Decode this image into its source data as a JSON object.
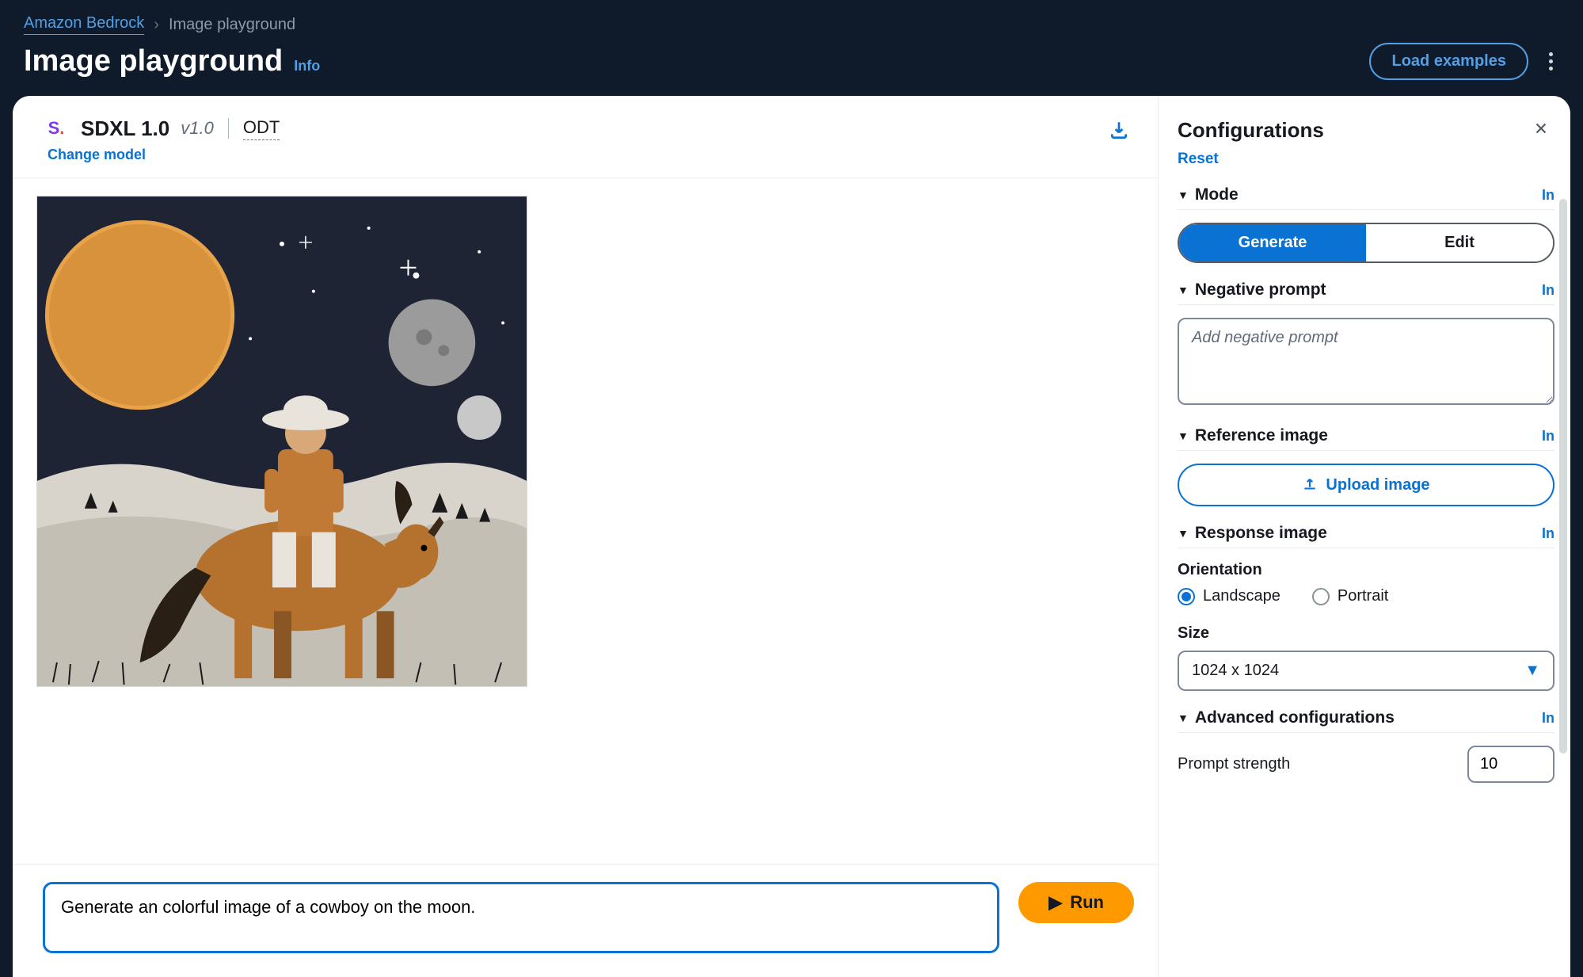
{
  "breadcrumb": {
    "root": "Amazon Bedrock",
    "current": "Image playground"
  },
  "page": {
    "title": "Image playground",
    "info": "Info",
    "load_examples": "Load examples"
  },
  "model": {
    "provider_short": "S",
    "name": "SDXL 1.0",
    "version": "v1.0",
    "odt": "ODT",
    "change": "Change model"
  },
  "prompt": {
    "value": "Generate an colorful image of a cowboy on the moon.",
    "run": "Run"
  },
  "config": {
    "title": "Configurations",
    "reset": "Reset",
    "info_label": "In",
    "mode": {
      "title": "Mode",
      "generate": "Generate",
      "edit": "Edit"
    },
    "negative": {
      "title": "Negative prompt",
      "placeholder": "Add negative prompt"
    },
    "reference": {
      "title": "Reference image",
      "upload": "Upload image"
    },
    "response": {
      "title": "Response image",
      "orientation_label": "Orientation",
      "landscape": "Landscape",
      "portrait": "Portrait",
      "size_label": "Size",
      "size_value": "1024 x 1024"
    },
    "advanced": {
      "title": "Advanced configurations",
      "prompt_strength_label": "Prompt strength",
      "prompt_strength_value": "10"
    }
  }
}
